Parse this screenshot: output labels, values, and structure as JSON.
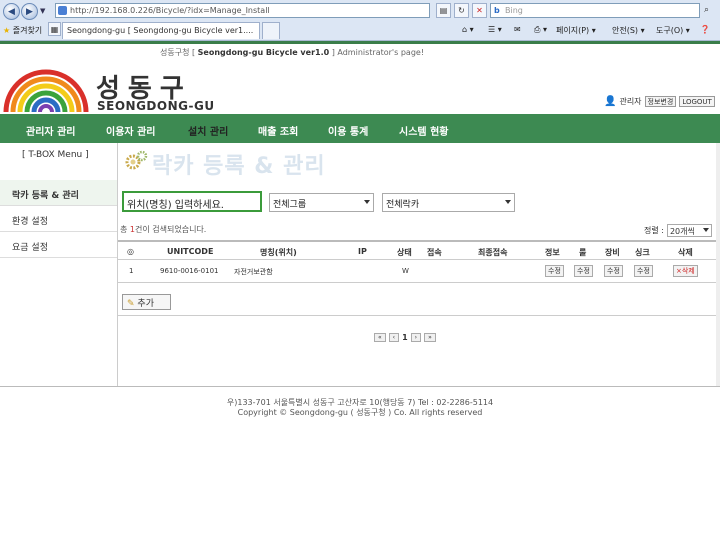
{
  "browser": {
    "url": "http://192.168.0.226/Bicycle/?idx=Manage_Install",
    "search_placeholder": "Bing",
    "favorites_label": "즐겨찾기",
    "tab_label": "Seongdong-gu [ Seongdong-gu Bicycle ver1....",
    "commands": {
      "page": "페이지(P)",
      "safety": "안전(S)",
      "tools": "도구(O)"
    }
  },
  "header": {
    "admin_prefix": "성동구청 [",
    "admin_system": "Seongdong-gu Bicycle ver1.0",
    "admin_suffix": "] Administrator's page!",
    "logo_korean": "성동구",
    "logo_english": "SEONGDONG-GU",
    "user_label": "관리자",
    "edit_info_button": "정보변경",
    "logout_button": "LOGOUT"
  },
  "nav": {
    "items": [
      {
        "label": "관리자 관리"
      },
      {
        "label": "이용자 관리"
      },
      {
        "label": "설치 관리"
      },
      {
        "label": "매출 조회"
      },
      {
        "label": "이용 통계"
      },
      {
        "label": "시스템 현황"
      }
    ]
  },
  "sidebar": {
    "title": "[ T-BOX Menu ]",
    "items": [
      {
        "label": "락카 등록 & 관리"
      },
      {
        "label": "환경 설정"
      },
      {
        "label": "요금 설정"
      }
    ]
  },
  "content": {
    "page_title": "락카 등록 & 관리",
    "search_value": "위치(명칭) 입력하세요.",
    "group_select": "전체그룹",
    "locker_select": "전체락카",
    "count_prefix": "총",
    "count_value": "1",
    "count_suffix": "건이 검색되었습니다.",
    "sort_label": "정렬 :",
    "sort_value": "20개씩",
    "columns": [
      "◎",
      "UNITCODE",
      "명칭(위치)",
      "IP",
      "상태",
      "접속",
      "최종접속",
      "정보",
      "룰",
      "장비",
      "싱크",
      "삭제"
    ],
    "rows": [
      {
        "no": "1",
        "unitcode": "9610-0016-0101",
        "name": "자전거보관함",
        "ip": "",
        "status": "W",
        "connect": "",
        "last": "",
        "info_btn": "수정",
        "rule_btn": "수정",
        "equip_btn": "수정",
        "sync_btn": "수정",
        "delete_btn": "×삭제"
      }
    ],
    "add_button": "추가",
    "pager": {
      "first": "«",
      "prev": "‹",
      "current": "1",
      "next": "›",
      "last": "»"
    }
  },
  "footer": {
    "line1": "우)133-701 서울특별시 성동구 고산자로 10(행당동 7) Tel : 02-2286-5114",
    "line2": "Copyright © Seongdong-gu ( 성동구청 ) Co. All rights reserved"
  },
  "colors": {
    "nav_green": "#3d8a52",
    "search_border": "#3b9b3b",
    "chrome_bg": "#dce6f4"
  }
}
